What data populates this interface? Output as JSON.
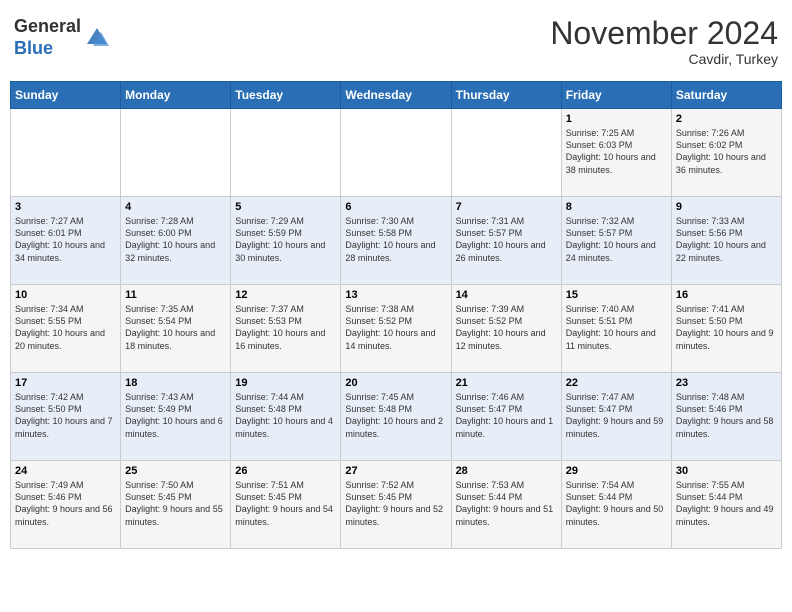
{
  "header": {
    "logo_general": "General",
    "logo_blue": "Blue",
    "month": "November 2024",
    "location": "Cavdir, Turkey"
  },
  "weekdays": [
    "Sunday",
    "Monday",
    "Tuesday",
    "Wednesday",
    "Thursday",
    "Friday",
    "Saturday"
  ],
  "weeks": [
    [
      {
        "day": "",
        "content": ""
      },
      {
        "day": "",
        "content": ""
      },
      {
        "day": "",
        "content": ""
      },
      {
        "day": "",
        "content": ""
      },
      {
        "day": "",
        "content": ""
      },
      {
        "day": "1",
        "content": "Sunrise: 7:25 AM\nSunset: 6:03 PM\nDaylight: 10 hours and 38 minutes."
      },
      {
        "day": "2",
        "content": "Sunrise: 7:26 AM\nSunset: 6:02 PM\nDaylight: 10 hours and 36 minutes."
      }
    ],
    [
      {
        "day": "3",
        "content": "Sunrise: 7:27 AM\nSunset: 6:01 PM\nDaylight: 10 hours and 34 minutes."
      },
      {
        "day": "4",
        "content": "Sunrise: 7:28 AM\nSunset: 6:00 PM\nDaylight: 10 hours and 32 minutes."
      },
      {
        "day": "5",
        "content": "Sunrise: 7:29 AM\nSunset: 5:59 PM\nDaylight: 10 hours and 30 minutes."
      },
      {
        "day": "6",
        "content": "Sunrise: 7:30 AM\nSunset: 5:58 PM\nDaylight: 10 hours and 28 minutes."
      },
      {
        "day": "7",
        "content": "Sunrise: 7:31 AM\nSunset: 5:57 PM\nDaylight: 10 hours and 26 minutes."
      },
      {
        "day": "8",
        "content": "Sunrise: 7:32 AM\nSunset: 5:57 PM\nDaylight: 10 hours and 24 minutes."
      },
      {
        "day": "9",
        "content": "Sunrise: 7:33 AM\nSunset: 5:56 PM\nDaylight: 10 hours and 22 minutes."
      }
    ],
    [
      {
        "day": "10",
        "content": "Sunrise: 7:34 AM\nSunset: 5:55 PM\nDaylight: 10 hours and 20 minutes."
      },
      {
        "day": "11",
        "content": "Sunrise: 7:35 AM\nSunset: 5:54 PM\nDaylight: 10 hours and 18 minutes."
      },
      {
        "day": "12",
        "content": "Sunrise: 7:37 AM\nSunset: 5:53 PM\nDaylight: 10 hours and 16 minutes."
      },
      {
        "day": "13",
        "content": "Sunrise: 7:38 AM\nSunset: 5:52 PM\nDaylight: 10 hours and 14 minutes."
      },
      {
        "day": "14",
        "content": "Sunrise: 7:39 AM\nSunset: 5:52 PM\nDaylight: 10 hours and 12 minutes."
      },
      {
        "day": "15",
        "content": "Sunrise: 7:40 AM\nSunset: 5:51 PM\nDaylight: 10 hours and 11 minutes."
      },
      {
        "day": "16",
        "content": "Sunrise: 7:41 AM\nSunset: 5:50 PM\nDaylight: 10 hours and 9 minutes."
      }
    ],
    [
      {
        "day": "17",
        "content": "Sunrise: 7:42 AM\nSunset: 5:50 PM\nDaylight: 10 hours and 7 minutes."
      },
      {
        "day": "18",
        "content": "Sunrise: 7:43 AM\nSunset: 5:49 PM\nDaylight: 10 hours and 6 minutes."
      },
      {
        "day": "19",
        "content": "Sunrise: 7:44 AM\nSunset: 5:48 PM\nDaylight: 10 hours and 4 minutes."
      },
      {
        "day": "20",
        "content": "Sunrise: 7:45 AM\nSunset: 5:48 PM\nDaylight: 10 hours and 2 minutes."
      },
      {
        "day": "21",
        "content": "Sunrise: 7:46 AM\nSunset: 5:47 PM\nDaylight: 10 hours and 1 minute."
      },
      {
        "day": "22",
        "content": "Sunrise: 7:47 AM\nSunset: 5:47 PM\nDaylight: 9 hours and 59 minutes."
      },
      {
        "day": "23",
        "content": "Sunrise: 7:48 AM\nSunset: 5:46 PM\nDaylight: 9 hours and 58 minutes."
      }
    ],
    [
      {
        "day": "24",
        "content": "Sunrise: 7:49 AM\nSunset: 5:46 PM\nDaylight: 9 hours and 56 minutes."
      },
      {
        "day": "25",
        "content": "Sunrise: 7:50 AM\nSunset: 5:45 PM\nDaylight: 9 hours and 55 minutes."
      },
      {
        "day": "26",
        "content": "Sunrise: 7:51 AM\nSunset: 5:45 PM\nDaylight: 9 hours and 54 minutes."
      },
      {
        "day": "27",
        "content": "Sunrise: 7:52 AM\nSunset: 5:45 PM\nDaylight: 9 hours and 52 minutes."
      },
      {
        "day": "28",
        "content": "Sunrise: 7:53 AM\nSunset: 5:44 PM\nDaylight: 9 hours and 51 minutes."
      },
      {
        "day": "29",
        "content": "Sunrise: 7:54 AM\nSunset: 5:44 PM\nDaylight: 9 hours and 50 minutes."
      },
      {
        "day": "30",
        "content": "Sunrise: 7:55 AM\nSunset: 5:44 PM\nDaylight: 9 hours and 49 minutes."
      }
    ]
  ]
}
